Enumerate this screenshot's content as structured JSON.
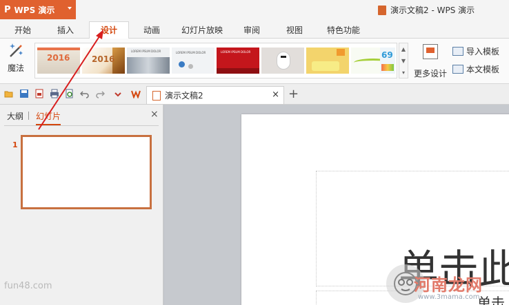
{
  "app": {
    "name": "WPS 演示",
    "logo_glyph": "P",
    "window_title": "演示文稿2 - WPS 演示"
  },
  "tabs": [
    {
      "label": "开始",
      "active": false
    },
    {
      "label": "插入",
      "active": false
    },
    {
      "label": "设计",
      "active": true
    },
    {
      "label": "动画",
      "active": false
    },
    {
      "label": "幻灯片放映",
      "active": false
    },
    {
      "label": "审阅",
      "active": false
    },
    {
      "label": "视图",
      "active": false
    },
    {
      "label": "特色功能",
      "active": false
    }
  ],
  "ribbon": {
    "magic_label": "魔法",
    "more_design_label": "更多设计",
    "import_template_label": "导入模板",
    "this_text_template_label": "本文模板",
    "thumbnail_texts": {
      "t1": "2016",
      "t2": "2016",
      "t3": "LOREM IPSUM DOLOR",
      "t4": "LOREM IPSUM DOLOR",
      "t5": "LOREM IPSUM DOLOR",
      "t8": "69"
    }
  },
  "document_tab": {
    "name": "演示文稿2",
    "close": "×",
    "add": "+"
  },
  "left_panel": {
    "tab_outline": "大纲",
    "tab_slides": "幻灯片",
    "close": "×",
    "slide_number": "1",
    "watermark": "fun48.com"
  },
  "slide": {
    "title_placeholder": "单击此",
    "subtitle_placeholder": "单击"
  },
  "watermark": {
    "site_name": "河南龙网",
    "site_url": "www.3mama.com"
  },
  "colors": {
    "accent": "#e0612f",
    "active_tab_text": "#d4470e",
    "annotation_arrow": "#d81e1e"
  }
}
